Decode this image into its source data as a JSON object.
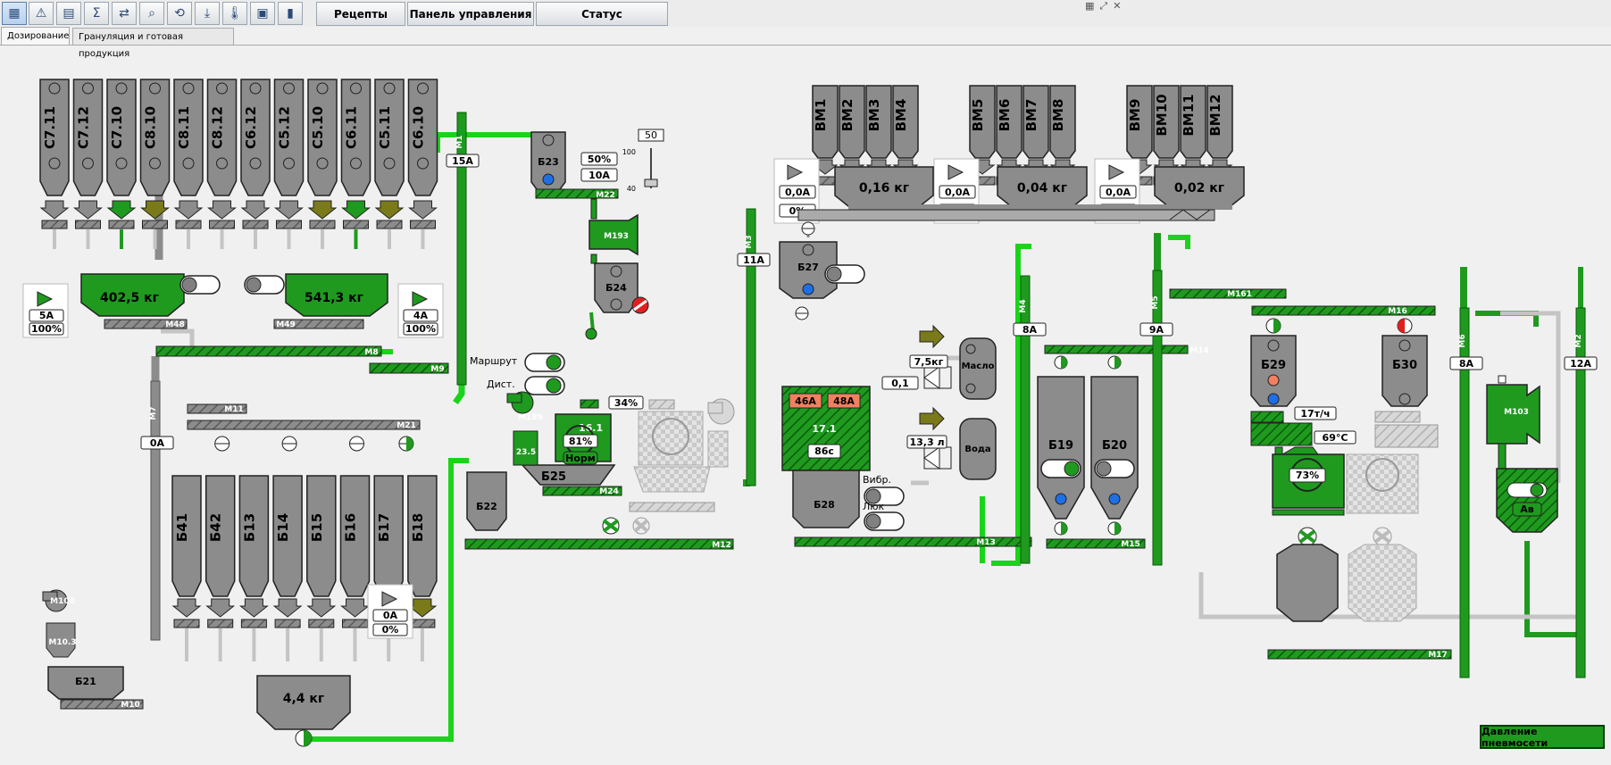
{
  "toolbar": {
    "icons": [
      "plant-icon",
      "warning-icon",
      "clipboard-icon",
      "sigma-icon",
      "transfer-icon",
      "search-icon",
      "cycle-icon",
      "download-icon",
      "thermometer-icon",
      "calendar-icon",
      "chart-icon"
    ],
    "buttons": [
      "Рецепты",
      "Панель управления",
      "Статус"
    ]
  },
  "tabs": [
    "Дозирование",
    "Грануляция и готовая продукция"
  ],
  "silos_c": [
    "С7.11",
    "С7.12",
    "С7.10",
    "С8.10",
    "С8.11",
    "С8.12",
    "С6.12",
    "С5.12",
    "С5.10",
    "С6.11",
    "С5.11",
    "С6.10"
  ],
  "silos_vm": [
    "ВМ1",
    "ВМ2",
    "ВМ3",
    "ВМ4",
    "ВМ5",
    "ВМ6",
    "ВМ7",
    "ВМ8",
    "ВМ9",
    "ВМ10",
    "ВМ11",
    "ВМ12"
  ],
  "silos_b": [
    "Б41",
    "Б42",
    "Б13",
    "Б14",
    "Б15",
    "Б16",
    "Б17",
    "Б18"
  ],
  "scales": {
    "w1": "402,5 кг",
    "w2": "541,3 кг",
    "w3": "4,4 кг",
    "vm1": "0,16 кг",
    "vm2": "0,04 кг",
    "vm3": "0,02 кг"
  },
  "panels": {
    "p1": {
      "a": "5А",
      "p": "100%"
    },
    "p2": {
      "a": "4А",
      "p": "100%"
    },
    "p3": {
      "a": "0А",
      "p": "0%"
    },
    "vm1": {
      "a": "0,0А",
      "p": "0%"
    },
    "vm2": {
      "a": "0,0А",
      "p": "0%"
    },
    "vm3": {
      "a": "0,0А",
      "p": "0%"
    }
  },
  "motors": {
    "M48": "M48",
    "M49": "M49",
    "M8": "M8",
    "M9": "M9",
    "M1": "M1",
    "M22": "M22",
    "M193": "M193",
    "M189": "M189",
    "M24": "M24",
    "M12": "M12",
    "M7": "M7",
    "M11": "M11",
    "M21": "M21",
    "M100": "M100",
    "M10_3": "M10.3",
    "M10": "M10",
    "M3": "M3",
    "M4": "M4",
    "M5": "M5",
    "M13": "M13",
    "M14": "M14",
    "M15": "M15",
    "M161": "M161",
    "M16": "M16",
    "M17": "M17",
    "M6": "M6",
    "M2": "M2",
    "M103": "M103"
  },
  "currents": {
    "m1": "15А",
    "m7": "0А",
    "m3": "11А",
    "m4": "8А",
    "m5": "9А",
    "m6": "8А",
    "m2": "12А"
  },
  "bunkers": {
    "b23": "Б23",
    "b24": "Б24",
    "b25": "Б25",
    "b22": "Б22",
    "b21": "Б21",
    "b27": "Б27",
    "b28": "Б28",
    "b19": "Б19",
    "b20": "Б20",
    "b29": "Б29",
    "b30": "Б30"
  },
  "b23_panel": {
    "p": "50%",
    "a": "10А"
  },
  "slider": {
    "value": "50",
    "max": "100",
    "min": "40"
  },
  "b25": {
    "temp": "16.1",
    "level": "81%",
    "mode": "Норм",
    "left": "23.5"
  },
  "b25_pct": "34%",
  "route_label": "Маршрут",
  "dist_label": "Дист.",
  "b28": {
    "a1": "46А",
    "a2": "48А",
    "temp": "17.1",
    "time": "86с"
  },
  "vibr_label": "Вибр.",
  "hatch_label": "Люк",
  "oil": {
    "label": "Масло",
    "value": "7,5кг",
    "val2": "0,1"
  },
  "water": {
    "label": "Вода",
    "value": "13,3 л"
  },
  "b29": {
    "rate": "17т/ч",
    "temp": "69°C",
    "level": "73%"
  },
  "av_label": "Ав",
  "pressure_button": "Давление пневмосети",
  "colors": {
    "green": "#1f9a1f",
    "darkgreen": "#0a5a0a",
    "bright": "#1ad41a",
    "grey": "#8c8c8c",
    "pipe_grey": "#c4c4c4",
    "olive": "#7a7a1a",
    "alarm": "#e02020",
    "orange": "#f08060",
    "blue": "#1e6fe6"
  }
}
